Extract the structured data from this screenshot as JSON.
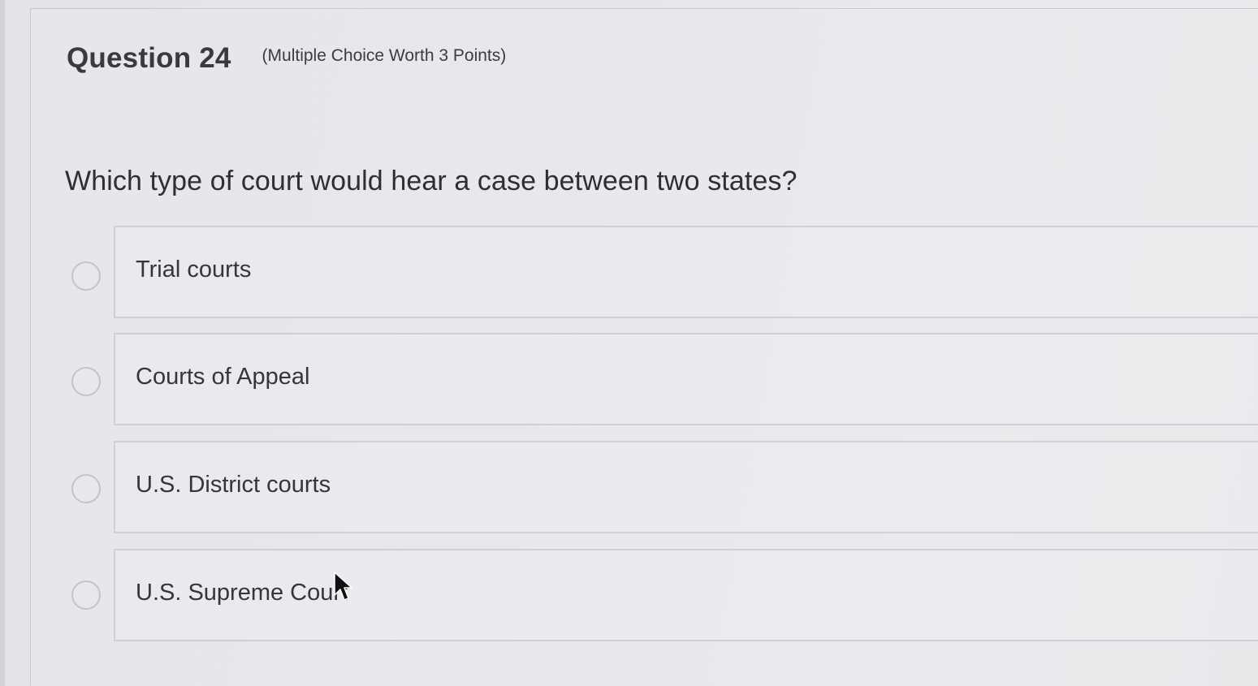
{
  "question": {
    "title": "Question 24",
    "meta": "(Multiple Choice Worth 3 Points)",
    "text": "Which type of court would hear a case between two states?"
  },
  "options": [
    {
      "label": "Trial courts"
    },
    {
      "label": "Courts of Appeal"
    },
    {
      "label": "U.S. District courts"
    },
    {
      "label": "U.S. Supreme Court"
    }
  ],
  "colors": {
    "background": "#e6e6ea",
    "border": "#cfcfd4",
    "text": "#2f2f33"
  },
  "icons": {
    "cursor": "mouse-pointer-icon",
    "radio": "radio-button-icon"
  }
}
